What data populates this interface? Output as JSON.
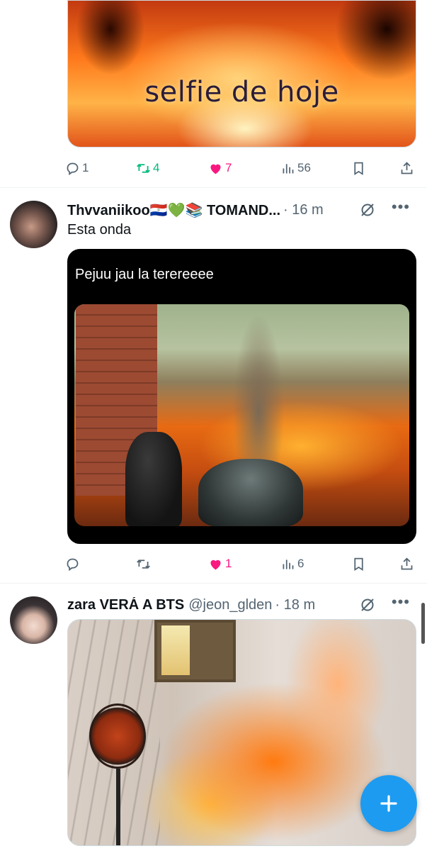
{
  "tweets": [
    {
      "id": "tweet-1",
      "image_caption": "selfie de hoje",
      "actions": {
        "reply": "1",
        "retweet": "4",
        "like": "7",
        "views": "56"
      }
    },
    {
      "id": "tweet-2",
      "name": "Thvvaniikoo🇵🇾💚📚 TOMAND...",
      "time": "· 16 m",
      "text": "Esta onda",
      "image_caption": "Pejuu jau la terereeee",
      "actions": {
        "reply": "",
        "retweet": "",
        "like": "1",
        "views": "6"
      }
    },
    {
      "id": "tweet-3",
      "name": "zara VERÁ A BTS",
      "handle": "@jeon_glden",
      "time": "· 18 m"
    }
  ],
  "colors": {
    "accent": "#1d9bf0",
    "retweet_active": "#00ba7c",
    "like_active": "#f91880",
    "muted": "#536471"
  },
  "icons": [
    "reply-icon",
    "retweet-icon",
    "like-icon",
    "views-icon",
    "bookmark-icon",
    "share-icon",
    "grok-icon",
    "more-icon",
    "compose-icon"
  ]
}
